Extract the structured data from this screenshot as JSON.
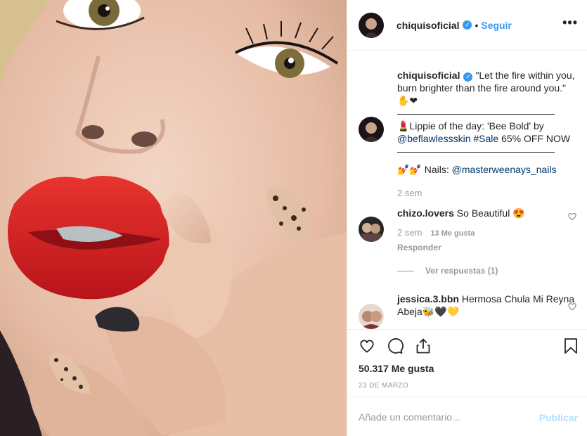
{
  "post_header": {
    "username": "chiquisoficial",
    "separator": "•",
    "follow_label": "Seguir",
    "more_label": "•••"
  },
  "caption": {
    "username": "chiquisoficial",
    "line1": "\"Let the fire within you, burn brighter than the fire around you.\" ✋❤",
    "divider": "————————————————",
    "line2_prefix": "💄Lippie of the day: 'Bee Bold' by ",
    "mention": "@beflawlessskin",
    "hashtag": " #Sale",
    "line2_suffix": " 65% OFF NOW",
    "nails_prefix": "💅💅 Nails: ",
    "nails_mention": "@masterweenays_nails",
    "time": "2 sem"
  },
  "comments": [
    {
      "username": "chizo.lovers",
      "text": " So Beautiful 😍",
      "time": "2 sem",
      "likes": "13 Me gusta",
      "reply_label": "Responder",
      "view_replies": "Ver respuestas (1)"
    },
    {
      "username": "jessica.3.bbn",
      "text": " Hermosa Chula Mi Reyna Abeja🐝🖤💛"
    }
  ],
  "actions": {
    "like_icon": "heart-icon",
    "comment_icon": "comment-icon",
    "share_icon": "share-icon",
    "save_icon": "bookmark-icon",
    "likes": "50.317 Me gusta",
    "date": "23 DE MARZO"
  },
  "add_comment": {
    "placeholder": "Añade un comentario...",
    "publish_label": "Publicar"
  },
  "colors": {
    "accent": "#3897f0",
    "link": "#003569",
    "muted": "#999999",
    "publish_disabled": "#b2dffc"
  }
}
